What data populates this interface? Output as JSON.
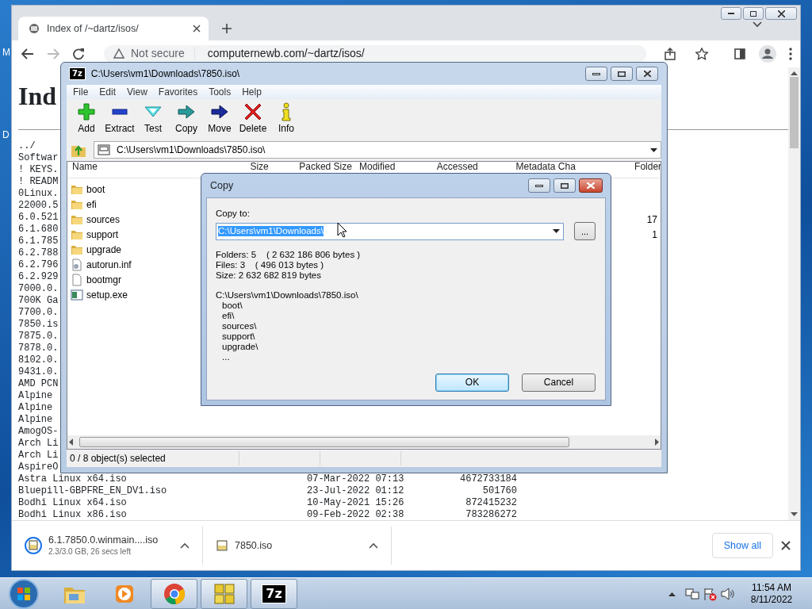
{
  "desktop": {
    "icon_labels": [
      "M",
      "D"
    ]
  },
  "browser": {
    "tab": {
      "title": "Index of /~dartz/isos/",
      "selected": true
    },
    "nav": {
      "forward_disabled": true
    },
    "address": {
      "security": "Not secure",
      "url": "computernewb.com/~dartz/isos/"
    },
    "page": {
      "heading": "Ind",
      "links": [
        "../",
        "Softwar",
        "! KEYS.",
        "! READM",
        "0Linux.",
        "22000.5",
        "6.0.521",
        "6.1.680",
        "6.1.785",
        "6.2.788",
        "6.2.796",
        "6.2.929",
        "7000.0.",
        "700K Ga",
        "7700.0.",
        "7850.is",
        "7875.0.",
        "7878.0.",
        "8102.0.",
        "9431.0.",
        "AMD PCN",
        "Alpine",
        "Alpine",
        "Alpine",
        "AmogOS-",
        "Arch Li",
        "Arch Li",
        "AspireO"
      ],
      "rows": [
        {
          "name": "Astra Linux x64.iso",
          "modified": "07-Mar-2022 07:13",
          "size": "4672733184"
        },
        {
          "name": "Bluepill-GBPFRE_EN_DV1.iso",
          "modified": "23-Jul-2022 01:12",
          "size": "501760"
        },
        {
          "name": "Bodhi Linux x64.iso",
          "modified": "10-May-2021 15:26",
          "size": "872415232"
        },
        {
          "name": "Bodhi Linux x86.iso",
          "modified": "09-Feb-2022 02:38",
          "size": "783286272"
        }
      ]
    },
    "downloads": [
      {
        "name": "6.1.7850.0.winmain....iso",
        "status": "2.3/3.0 GB, 26 secs left"
      },
      {
        "name": "7850.iso"
      }
    ],
    "show_all": "Show all"
  },
  "archive_window": {
    "logo": "7z",
    "title": "C:\\Users\\vm1\\Downloads\\7850.iso\\",
    "menu": [
      "File",
      "Edit",
      "View",
      "Favorites",
      "Tools",
      "Help"
    ],
    "toolbar": [
      {
        "label": "Add",
        "kind": "add"
      },
      {
        "label": "Extract",
        "kind": "extract"
      },
      {
        "label": "Test",
        "kind": "test"
      },
      {
        "label": "Copy",
        "kind": "copy"
      },
      {
        "label": "Move",
        "kind": "move"
      },
      {
        "label": "Delete",
        "kind": "delete"
      },
      {
        "label": "Info",
        "kind": "info"
      }
    ],
    "path": "C:\\Users\\vm1\\Downloads\\7850.iso\\",
    "columns": [
      "Name",
      "Size",
      "Packed Size",
      "Modified",
      "Accessed",
      "Metadata Cha",
      "Folder"
    ],
    "files": [
      {
        "name": "boot",
        "kind": "folder"
      },
      {
        "name": "efi",
        "kind": "folder"
      },
      {
        "name": "sources",
        "kind": "folder",
        "folders": "17"
      },
      {
        "name": "support",
        "kind": "folder",
        "folders": "1"
      },
      {
        "name": "upgrade",
        "kind": "folder"
      },
      {
        "name": "autorun.inf",
        "kind": "settings"
      },
      {
        "name": "bootmgr",
        "kind": "file"
      },
      {
        "name": "setup.exe",
        "kind": "program"
      }
    ],
    "status": "0 / 8 object(s) selected"
  },
  "copy_dialog": {
    "title": "Copy",
    "label": "Copy to:",
    "destination": "C:\\Users\\vm1\\Downloads\\",
    "destination_selected": true,
    "browse": "...",
    "summary": [
      "Folders: 5    ( 2 632 186 806 bytes )",
      "Files: 3    ( 496 013 bytes )",
      "Size: 2 632 682 819 bytes"
    ],
    "source_path": "C:\\Users\\vm1\\Downloads\\7850.iso\\",
    "items": [
      "boot\\",
      "efi\\",
      "sources\\",
      "support\\",
      "upgrade\\",
      "..."
    ],
    "buttons": [
      {
        "label": "OK",
        "default": true
      },
      {
        "label": "Cancel",
        "default": false
      }
    ]
  },
  "taskbar": {
    "apps": [
      {
        "kind": "explorer",
        "running": false
      },
      {
        "kind": "media",
        "running": false
      },
      {
        "kind": "browser",
        "running": true
      },
      {
        "kind": "vm",
        "running": true
      },
      {
        "kind": "archiver",
        "running": true,
        "logo": "7z"
      }
    ],
    "time": "11:54 AM",
    "date": "8/11/2022"
  }
}
